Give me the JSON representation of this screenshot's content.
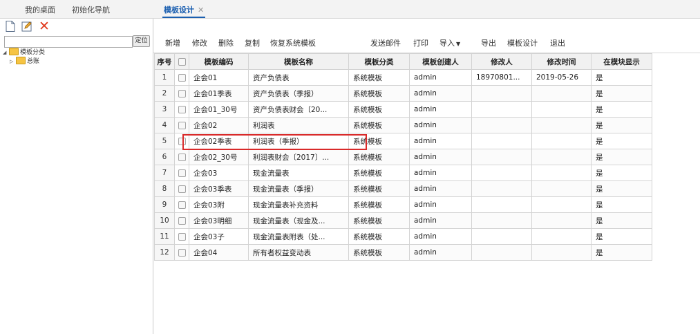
{
  "tabs": {
    "desk": "我的桌面",
    "nav": "初始化导航",
    "active": "模板设计",
    "close": "✕"
  },
  "left": {
    "search_placeholder": "",
    "locate_label": "定位",
    "tree": {
      "root": "模板分类",
      "child": "总账"
    }
  },
  "toolbar": {
    "items": [
      "新增",
      "修改",
      "删除",
      "复制",
      "恢复系统模板",
      "发送邮件",
      "打印",
      "导入",
      "导出",
      "模板设计",
      "退出"
    ]
  },
  "table": {
    "columns": [
      "序号",
      "",
      "模板编码",
      "模板名称",
      "模板分类",
      "模板创建人",
      "修改人",
      "修改时间",
      "在模块显示"
    ],
    "rows": [
      [
        "1",
        "",
        "企会01",
        "资产负债表",
        "系统模板",
        "admin",
        "18970801...",
        "2019-05-26",
        "是"
      ],
      [
        "2",
        "",
        "企会01季表",
        "资产负债表（季报）",
        "系统模板",
        "admin",
        "",
        "",
        "是"
      ],
      [
        "3",
        "",
        "企会01_30号",
        "资产负债表财会〔20...",
        "系统模板",
        "admin",
        "",
        "",
        "是"
      ],
      [
        "4",
        "",
        "企会02",
        "利润表",
        "系统模板",
        "admin",
        "",
        "",
        "是"
      ],
      [
        "5",
        "",
        "企会02季表",
        "利润表（季报）",
        "系统模板",
        "admin",
        "",
        "",
        "是"
      ],
      [
        "6",
        "",
        "企会02_30号",
        "利润表财会〔2017〕...",
        "系统模板",
        "admin",
        "",
        "",
        "是"
      ],
      [
        "7",
        "",
        "企会03",
        "现金流量表",
        "系统模板",
        "admin",
        "",
        "",
        "是"
      ],
      [
        "8",
        "",
        "企会03季表",
        "现金流量表（季报）",
        "系统模板",
        "admin",
        "",
        "",
        "是"
      ],
      [
        "9",
        "",
        "企会03附",
        "现金流量表补充资料",
        "系统模板",
        "admin",
        "",
        "",
        "是"
      ],
      [
        "10",
        "",
        "企会03明细",
        "现金流量表（现金及...",
        "系统模板",
        "admin",
        "",
        "",
        "是"
      ],
      [
        "11",
        "",
        "企会03子",
        "现金流量表附表（处...",
        "系统模板",
        "admin",
        "",
        "",
        "是"
      ],
      [
        "12",
        "",
        "企会04",
        "所有者权益变动表",
        "系统模板",
        "admin",
        "",
        "",
        "是"
      ]
    ]
  },
  "colors": {
    "highlight": "#d92a2a",
    "active_tab": "#1b5fb0",
    "delete_icon": "#e03a1e",
    "folder": "#f6c443"
  }
}
